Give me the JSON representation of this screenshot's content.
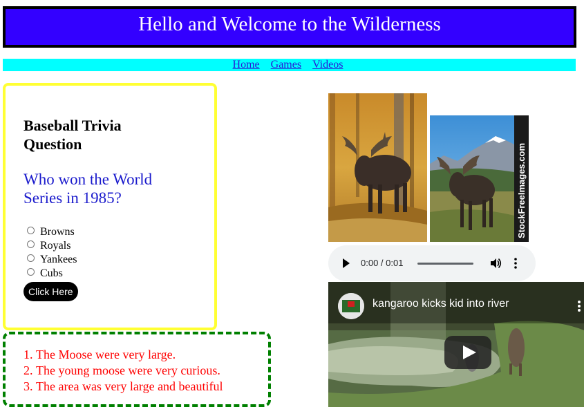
{
  "header": {
    "title": "Hello and Welcome to the Wilderness"
  },
  "nav": {
    "links": [
      "Home",
      "Games",
      "Videos"
    ]
  },
  "trivia": {
    "heading": "Baseball Trivia Question",
    "question": "Who won the World Series in 1985?",
    "options": [
      "Browns",
      "Royals",
      "Yankees",
      "Cubs"
    ],
    "button_label": "Click Here"
  },
  "facts": {
    "items": [
      "The Moose were very large.",
      "The young moose were very curious.",
      "The area was very large and beautiful"
    ]
  },
  "images": {
    "watermark": "StockFreeImages.com"
  },
  "audio": {
    "time": "0:00 / 0:01"
  },
  "video": {
    "title": "kangaroo kicks kid into river"
  },
  "colors": {
    "banner_bg": "#3300ff",
    "nav_bg": "#00ffff",
    "trivia_border": "#ffff33",
    "facts_border": "#008000",
    "facts_text": "#ff0000",
    "question_text": "#1a1acc"
  }
}
